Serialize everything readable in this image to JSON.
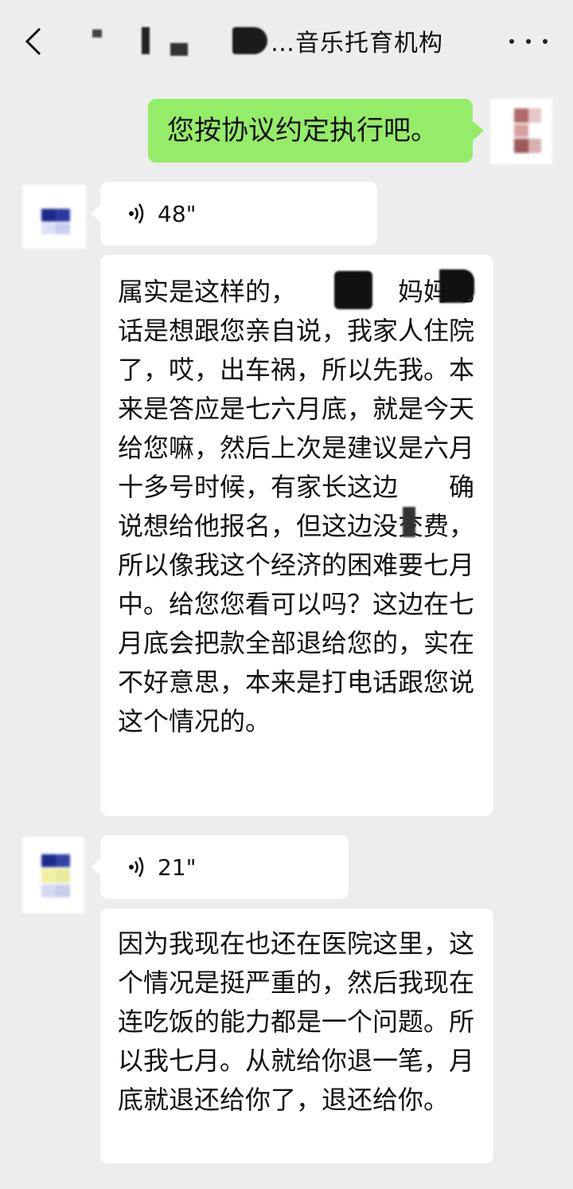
{
  "header": {
    "title_suffix": "…音乐托育机构",
    "back_icon": "chevron-left-icon",
    "more_icon": "more-dots-icon"
  },
  "messages": [
    {
      "side": "right",
      "type": "text",
      "text": "您按协议约定执行吧。"
    },
    {
      "side": "left",
      "type": "voice",
      "duration": "48\""
    },
    {
      "side": "left",
      "type": "text",
      "text": "属实是这样的，　　，　　妈妈电话是想跟您亲自说，我家人住院了，哎，出车祸，所以先我。本来是答应是七六月底，就是今天给您嘛，然后上次是建议是六月十多号时候，有家长这边　　确说想给他报名，但这边没交费，所以像我这个经济的困难要七月中。给您您看可以吗？这边在七月底会把款全部退给您的，实在不好意思，本来是打电话跟您说这个情况的。"
    },
    {
      "side": "left",
      "type": "voice",
      "duration": "21\""
    },
    {
      "side": "left",
      "type": "text",
      "text": "因为我现在也还在医院这里，这个情况是挺严重的，然后我现在连吃饭的能力都是一个问题。所以我七月。从就给你退一笔，月底就退还给你了，退还给你。"
    }
  ],
  "colors": {
    "background": "#ededed",
    "self_bubble": "#95ec69",
    "other_bubble": "#ffffff"
  }
}
